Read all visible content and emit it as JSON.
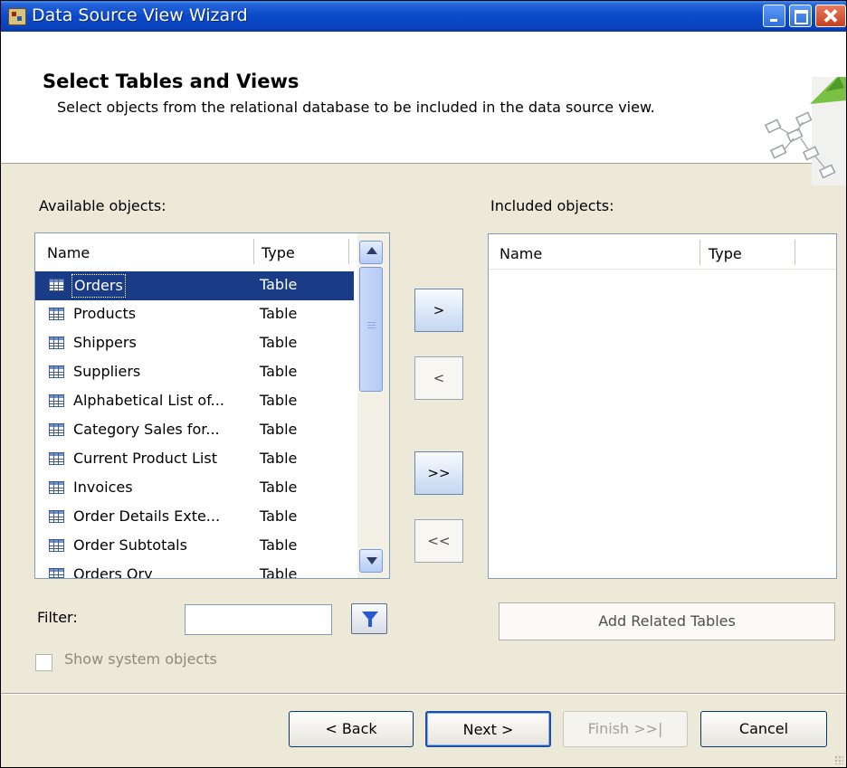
{
  "window": {
    "title": "Data Source View Wizard"
  },
  "header": {
    "title": "Select Tables and Views",
    "description": "Select objects from the relational database to be included in the data source view."
  },
  "available": {
    "label": "Available objects:",
    "columns": {
      "name": "Name",
      "type": "Type"
    },
    "rows": [
      {
        "name": "Orders",
        "type": "Table",
        "selected": true
      },
      {
        "name": "Products",
        "type": "Table"
      },
      {
        "name": "Shippers",
        "type": "Table"
      },
      {
        "name": "Suppliers",
        "type": "Table"
      },
      {
        "name": "Alphabetical List of...",
        "type": "Table"
      },
      {
        "name": "Category Sales for...",
        "type": "Table"
      },
      {
        "name": "Current Product List",
        "type": "Table"
      },
      {
        "name": "Invoices",
        "type": "Table"
      },
      {
        "name": "Order Details Exte...",
        "type": "Table"
      },
      {
        "name": "Order Subtotals",
        "type": "Table"
      },
      {
        "name": "Orders Qry",
        "type": "Table"
      }
    ]
  },
  "included": {
    "label": "Included objects:",
    "columns": {
      "name": "Name",
      "type": "Type"
    }
  },
  "move_buttons": {
    "add": ">",
    "remove": "<",
    "add_all": ">>",
    "remove_all": "<<"
  },
  "filter": {
    "label": "Filter:",
    "value": ""
  },
  "add_related_tables": "Add Related Tables",
  "show_system_objects": {
    "label": "Show system objects",
    "checked": false
  },
  "footer": {
    "back": "< Back",
    "next": "Next >",
    "finish": "Finish >>|",
    "cancel": "Cancel"
  },
  "colors": {
    "titlebar": "#0a49c9",
    "selection": "#1a3c87",
    "dialog": "#ece9d8"
  }
}
